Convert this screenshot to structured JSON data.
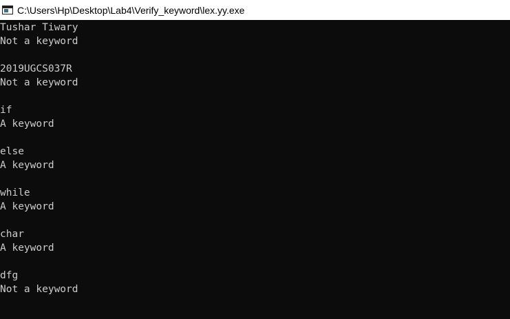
{
  "window": {
    "title": "C:\\Users\\Hp\\Desktop\\Lab4\\Verify_keyword\\lex.yy.exe",
    "icon": "console-icon"
  },
  "console": {
    "lines": [
      "Tushar Tiwary",
      "Not a keyword",
      "",
      "2019UGCS037R",
      "Not a keyword",
      "",
      "if",
      "A keyword",
      "",
      "else",
      "A keyword",
      "",
      "while",
      "A keyword",
      "",
      "char",
      "A keyword",
      "",
      "dfg",
      "Not a keyword"
    ]
  },
  "colors": {
    "background": "#0c0c0c",
    "text": "#cccccc",
    "titlebar": "#ffffff"
  }
}
